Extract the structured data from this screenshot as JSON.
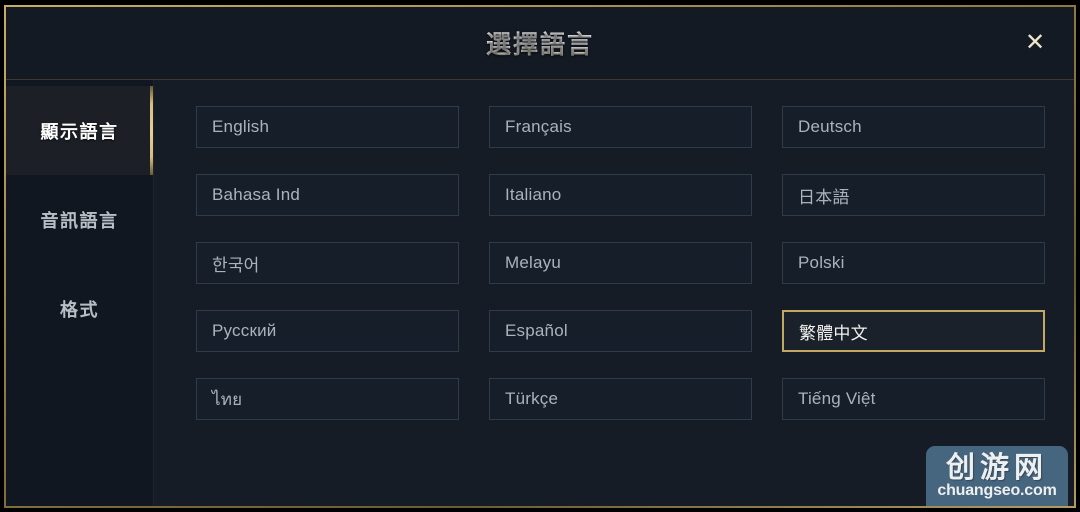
{
  "dialog": {
    "title": "選擇語言",
    "close_icon": "close-icon",
    "close_label": "✕"
  },
  "sidebar": {
    "items": [
      {
        "label": "顯示語言",
        "active": true
      },
      {
        "label": "音訊語言",
        "active": false
      },
      {
        "label": "格式",
        "active": false
      }
    ]
  },
  "languages": [
    {
      "label": "English",
      "selected": false
    },
    {
      "label": "Français",
      "selected": false
    },
    {
      "label": "Deutsch",
      "selected": false
    },
    {
      "label": "Bahasa Ind",
      "selected": false
    },
    {
      "label": "Italiano",
      "selected": false
    },
    {
      "label": "日本語",
      "selected": false
    },
    {
      "label": "한국어",
      "selected": false
    },
    {
      "label": "Melayu",
      "selected": false
    },
    {
      "label": "Polski",
      "selected": false
    },
    {
      "label": "Русский",
      "selected": false
    },
    {
      "label": "Español",
      "selected": false
    },
    {
      "label": "繁體中文",
      "selected": true
    },
    {
      "label": "ไทย",
      "selected": false
    },
    {
      "label": "Türkçe",
      "selected": false
    },
    {
      "label": "Tiếng Việt",
      "selected": false
    }
  ],
  "watermark": {
    "logo": "创游网",
    "url": "chuangseo.com"
  },
  "colors": {
    "accent_gold": "#c3a864",
    "frame_gold": "#8d7742",
    "dialog_bg": "#131a24",
    "sidebar_bg": "#101720",
    "content_bg": "#151c26",
    "button_border": "#2e3b49",
    "button_text": "#aab3bd",
    "watermark_bg": "#4a6b86"
  }
}
